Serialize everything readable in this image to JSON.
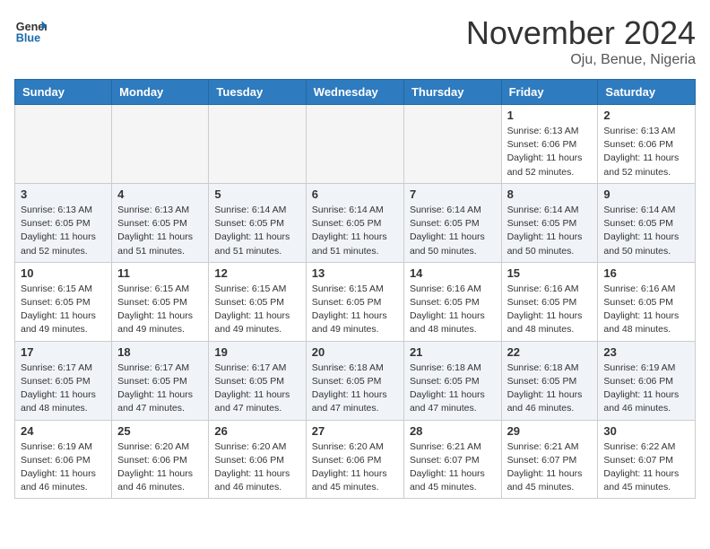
{
  "header": {
    "logo_general": "General",
    "logo_blue": "Blue",
    "month_title": "November 2024",
    "location": "Oju, Benue, Nigeria"
  },
  "days_of_week": [
    "Sunday",
    "Monday",
    "Tuesday",
    "Wednesday",
    "Thursday",
    "Friday",
    "Saturday"
  ],
  "weeks": [
    [
      {
        "day": "",
        "empty": true
      },
      {
        "day": "",
        "empty": true
      },
      {
        "day": "",
        "empty": true
      },
      {
        "day": "",
        "empty": true
      },
      {
        "day": "",
        "empty": true
      },
      {
        "day": "1",
        "sunrise": "6:13 AM",
        "sunset": "6:06 PM",
        "daylight": "11 hours and 52 minutes."
      },
      {
        "day": "2",
        "sunrise": "6:13 AM",
        "sunset": "6:06 PM",
        "daylight": "11 hours and 52 minutes."
      }
    ],
    [
      {
        "day": "3",
        "sunrise": "6:13 AM",
        "sunset": "6:05 PM",
        "daylight": "11 hours and 52 minutes."
      },
      {
        "day": "4",
        "sunrise": "6:13 AM",
        "sunset": "6:05 PM",
        "daylight": "11 hours and 51 minutes."
      },
      {
        "day": "5",
        "sunrise": "6:14 AM",
        "sunset": "6:05 PM",
        "daylight": "11 hours and 51 minutes."
      },
      {
        "day": "6",
        "sunrise": "6:14 AM",
        "sunset": "6:05 PM",
        "daylight": "11 hours and 51 minutes."
      },
      {
        "day": "7",
        "sunrise": "6:14 AM",
        "sunset": "6:05 PM",
        "daylight": "11 hours and 50 minutes."
      },
      {
        "day": "8",
        "sunrise": "6:14 AM",
        "sunset": "6:05 PM",
        "daylight": "11 hours and 50 minutes."
      },
      {
        "day": "9",
        "sunrise": "6:14 AM",
        "sunset": "6:05 PM",
        "daylight": "11 hours and 50 minutes."
      }
    ],
    [
      {
        "day": "10",
        "sunrise": "6:15 AM",
        "sunset": "6:05 PM",
        "daylight": "11 hours and 49 minutes."
      },
      {
        "day": "11",
        "sunrise": "6:15 AM",
        "sunset": "6:05 PM",
        "daylight": "11 hours and 49 minutes."
      },
      {
        "day": "12",
        "sunrise": "6:15 AM",
        "sunset": "6:05 PM",
        "daylight": "11 hours and 49 minutes."
      },
      {
        "day": "13",
        "sunrise": "6:15 AM",
        "sunset": "6:05 PM",
        "daylight": "11 hours and 49 minutes."
      },
      {
        "day": "14",
        "sunrise": "6:16 AM",
        "sunset": "6:05 PM",
        "daylight": "11 hours and 48 minutes."
      },
      {
        "day": "15",
        "sunrise": "6:16 AM",
        "sunset": "6:05 PM",
        "daylight": "11 hours and 48 minutes."
      },
      {
        "day": "16",
        "sunrise": "6:16 AM",
        "sunset": "6:05 PM",
        "daylight": "11 hours and 48 minutes."
      }
    ],
    [
      {
        "day": "17",
        "sunrise": "6:17 AM",
        "sunset": "6:05 PM",
        "daylight": "11 hours and 48 minutes."
      },
      {
        "day": "18",
        "sunrise": "6:17 AM",
        "sunset": "6:05 PM",
        "daylight": "11 hours and 47 minutes."
      },
      {
        "day": "19",
        "sunrise": "6:17 AM",
        "sunset": "6:05 PM",
        "daylight": "11 hours and 47 minutes."
      },
      {
        "day": "20",
        "sunrise": "6:18 AM",
        "sunset": "6:05 PM",
        "daylight": "11 hours and 47 minutes."
      },
      {
        "day": "21",
        "sunrise": "6:18 AM",
        "sunset": "6:05 PM",
        "daylight": "11 hours and 47 minutes."
      },
      {
        "day": "22",
        "sunrise": "6:18 AM",
        "sunset": "6:05 PM",
        "daylight": "11 hours and 46 minutes."
      },
      {
        "day": "23",
        "sunrise": "6:19 AM",
        "sunset": "6:06 PM",
        "daylight": "11 hours and 46 minutes."
      }
    ],
    [
      {
        "day": "24",
        "sunrise": "6:19 AM",
        "sunset": "6:06 PM",
        "daylight": "11 hours and 46 minutes."
      },
      {
        "day": "25",
        "sunrise": "6:20 AM",
        "sunset": "6:06 PM",
        "daylight": "11 hours and 46 minutes."
      },
      {
        "day": "26",
        "sunrise": "6:20 AM",
        "sunset": "6:06 PM",
        "daylight": "11 hours and 46 minutes."
      },
      {
        "day": "27",
        "sunrise": "6:20 AM",
        "sunset": "6:06 PM",
        "daylight": "11 hours and 45 minutes."
      },
      {
        "day": "28",
        "sunrise": "6:21 AM",
        "sunset": "6:07 PM",
        "daylight": "11 hours and 45 minutes."
      },
      {
        "day": "29",
        "sunrise": "6:21 AM",
        "sunset": "6:07 PM",
        "daylight": "11 hours and 45 minutes."
      },
      {
        "day": "30",
        "sunrise": "6:22 AM",
        "sunset": "6:07 PM",
        "daylight": "11 hours and 45 minutes."
      }
    ]
  ]
}
